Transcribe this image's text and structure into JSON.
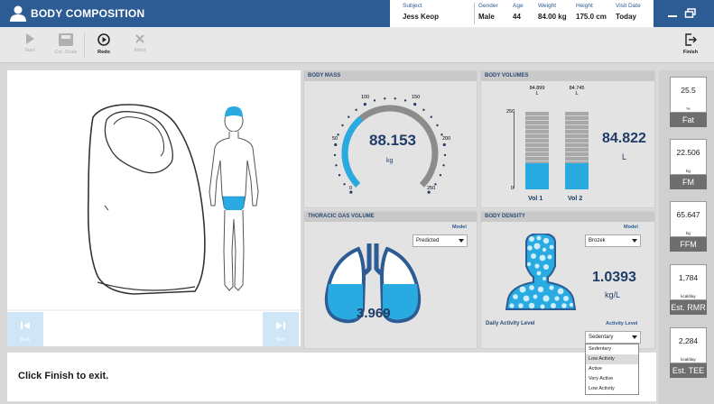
{
  "header": {
    "title": "BODY COMPOSITION",
    "subject_label": "Subject",
    "subject_value": "Jess Keop",
    "gender_label": "Gender",
    "gender_value": "Male",
    "age_label": "Age",
    "age_value": "44",
    "weight_label": "Weight",
    "weight_value": "84.00 kg",
    "height_label": "Height",
    "height_value": "175.0 cm",
    "visit_label": "Visit Date",
    "visit_value": "Today"
  },
  "toolbar": {
    "start": "Start",
    "cal_scale": "Cal. Scale",
    "redo": "Redo",
    "abort": "Abort",
    "finish": "Finish"
  },
  "nav": {
    "back": "Back",
    "next": "Next"
  },
  "body_mass": {
    "title": "BODY MASS",
    "value": "88.153",
    "unit": "kg",
    "ticks": [
      "0",
      "50",
      "100",
      "150",
      "200",
      "250"
    ],
    "gauge_min": 0,
    "gauge_max": 250,
    "gauge_value": 88.153
  },
  "body_volumes": {
    "title": "BODY VOLUMES",
    "value": "84.822",
    "unit": "L",
    "vol1_top": "84.899",
    "vol1_unit": "L",
    "vol2_top": "84.745",
    "vol2_unit": "L",
    "axis_max": "250",
    "axis_min": "0",
    "vol1_label": "Vol 1",
    "vol2_label": "Vol 2"
  },
  "tgv": {
    "title": "THORACIC GAS VOLUME",
    "model_label": "Model",
    "model_value": "Predicted",
    "value": "3.969"
  },
  "density": {
    "title": "BODY DENSITY",
    "model_label": "Model",
    "model_value": "Brozek",
    "value": "1.0393",
    "unit": "kg/L",
    "activity_left": "Daily Activity Level",
    "activity_label": "Activity Level",
    "activity_value": "Sedentary",
    "options": [
      "Sedentary",
      "Low Activity",
      "Active",
      "Very Active",
      "Low Activity"
    ]
  },
  "metrics": [
    {
      "value": "25.5",
      "unit": "%",
      "label": "Fat"
    },
    {
      "value": "22.506",
      "unit": "kg",
      "label": "FM"
    },
    {
      "value": "65.647",
      "unit": "kg",
      "label": "FFM"
    },
    {
      "value": "1,784",
      "unit": "kcal/day",
      "label": "Est. RMR"
    },
    {
      "value": "2,284",
      "unit": "kcal/day",
      "label": "Est. TEE"
    }
  ],
  "message": "Click Finish to exit.",
  "colors": {
    "header": "#2d5b94",
    "accent": "#29abe2",
    "dark_text": "#1f3d66"
  }
}
